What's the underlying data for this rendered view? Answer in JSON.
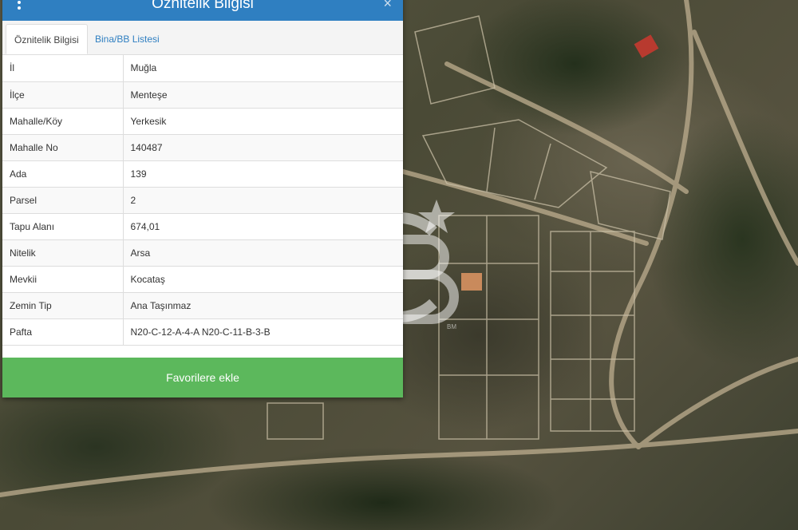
{
  "panel": {
    "title": "Öznitelik Bilgisi",
    "close_icon": "×",
    "tabs": [
      {
        "label": "Öznitelik Bilgisi",
        "active": true
      },
      {
        "label": "Bina/BB Listesi",
        "active": false
      }
    ],
    "rows": [
      {
        "key": "İl",
        "value": "Muğla"
      },
      {
        "key": "İlçe",
        "value": "Menteşe"
      },
      {
        "key": "Mahalle/Köy",
        "value": "Yerkesik"
      },
      {
        "key": "Mahalle No",
        "value": "140487"
      },
      {
        "key": "Ada",
        "value": "139"
      },
      {
        "key": "Parsel",
        "value": "2"
      },
      {
        "key": "Tapu Alanı",
        "value": "674,01"
      },
      {
        "key": "Nitelik",
        "value": "Arsa"
      },
      {
        "key": "Mevkii",
        "value": "Kocataş"
      },
      {
        "key": "Zemin Tip",
        "value": "Ana Taşınmaz"
      },
      {
        "key": "Pafta",
        "value": "N20-C-12-A-4-A N20-C-11-B-3-B"
      }
    ],
    "favorite_button": "Favorilere ekle"
  },
  "watermark": {
    "caption": "BM"
  },
  "colors": {
    "header": "#2f7fc1",
    "button": "#5cb85c"
  }
}
